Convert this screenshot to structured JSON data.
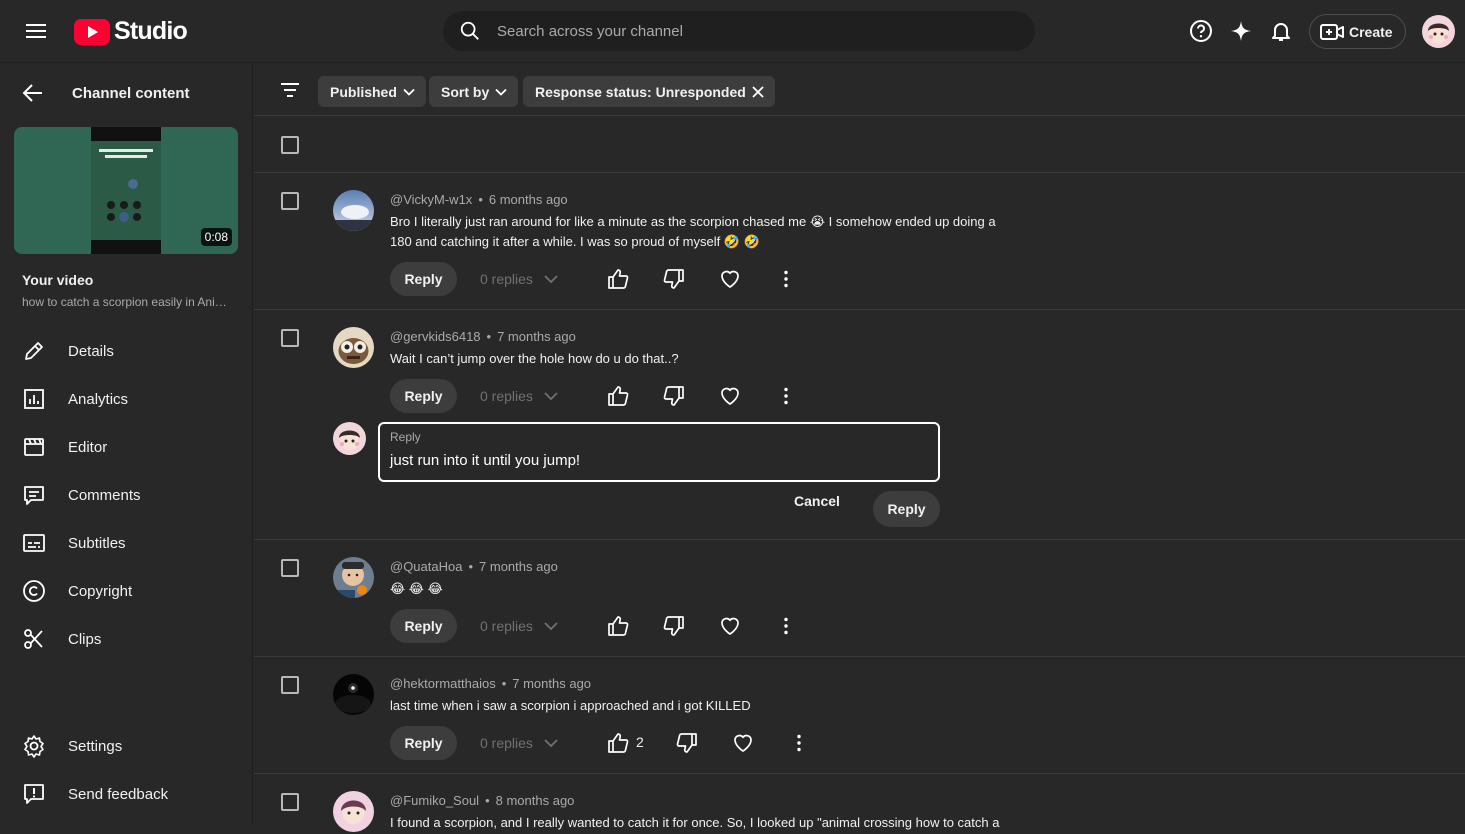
{
  "header": {
    "brand": "Studio",
    "search_placeholder": "Search across your channel",
    "create_label": "Create"
  },
  "sidebar": {
    "back_label": "Channel content",
    "video": {
      "duration": "0:08",
      "title": "Your video",
      "subtitle": "how to catch a scorpion easily in Animal Crossing"
    },
    "items": [
      {
        "label": "Details",
        "icon": "pencil-icon"
      },
      {
        "label": "Analytics",
        "icon": "analytics-icon"
      },
      {
        "label": "Editor",
        "icon": "clapperboard-icon"
      },
      {
        "label": "Comments",
        "icon": "comment-icon"
      },
      {
        "label": "Subtitles",
        "icon": "subtitles-icon"
      },
      {
        "label": "Copyright",
        "icon": "copyright-icon"
      },
      {
        "label": "Clips",
        "icon": "scissors-icon"
      }
    ],
    "bottom_items": [
      {
        "label": "Settings",
        "icon": "gear-icon"
      },
      {
        "label": "Send feedback",
        "icon": "feedback-icon"
      }
    ]
  },
  "filters": {
    "published": "Published",
    "sort": "Sort by",
    "response_status": "Response status: Unresponded"
  },
  "comments": [
    {
      "author": "@VickyM-w1x",
      "time": "6 months ago",
      "text": "Bro I literally just ran around for like a minute as the scorpion chased me 😭 I somehow ended up doing a 180 and catching it after a while. I was so proud of myself 🤣 🤣",
      "replies": "0 replies",
      "likes": ""
    },
    {
      "author": "@gervkids6418",
      "time": "7 months ago",
      "text": "Wait I can’t jump over the hole how do u do that..?",
      "replies": "0 replies",
      "likes": ""
    },
    {
      "author": "@QuataHoa",
      "time": "7 months ago",
      "text": "😂 😂 😂",
      "replies": "0 replies",
      "likes": ""
    },
    {
      "author": "@hektormatthaios",
      "time": "7 months ago",
      "text": "last time when i saw a scorpion i approached and i got KILLED",
      "replies": "0 replies",
      "likes": "2"
    },
    {
      "author": "@Fumiko_Soul",
      "time": "8 months ago",
      "text": "I found a scorpion, and I really wanted to catch it for once. So, I looked up \"animal crossing how to catch a",
      "replies": "",
      "likes": ""
    }
  ],
  "actions": {
    "reply_label": "Reply"
  },
  "reply_editor": {
    "label": "Reply",
    "value": "just run into it until you jump!",
    "cancel": "Cancel",
    "submit": "Reply"
  },
  "colors": {
    "background": "#282828",
    "youtube_red": "#ff0033",
    "chip": "#3d3d3d"
  }
}
